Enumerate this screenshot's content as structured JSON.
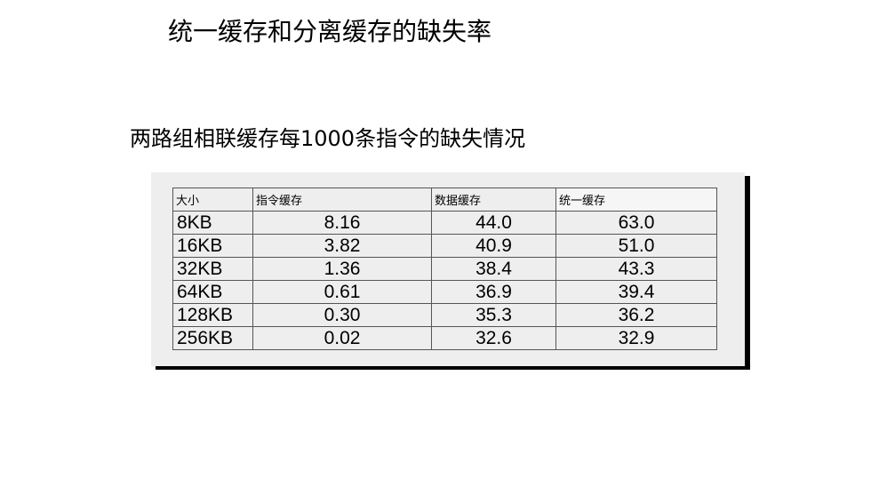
{
  "slide": {
    "title": "统一缓存和分离缓存的缺失率",
    "subtitle": "两路组相联缓存每1000条指令的缺失情况"
  },
  "table": {
    "headers": [
      "大小",
      "指令缓存",
      "数据缓存",
      "统一缓存"
    ],
    "rows": [
      [
        "8KB",
        "8.16",
        "44.0",
        "63.0"
      ],
      [
        "16KB",
        "3.82",
        "40.9",
        "51.0"
      ],
      [
        "32KB",
        "1.36",
        "38.4",
        "43.3"
      ],
      [
        "64KB",
        "0.61",
        "36.9",
        "39.4"
      ],
      [
        "128KB",
        "0.30",
        "35.3",
        "36.2"
      ],
      [
        "256KB",
        "0.02",
        "32.6",
        "32.9"
      ]
    ]
  }
}
